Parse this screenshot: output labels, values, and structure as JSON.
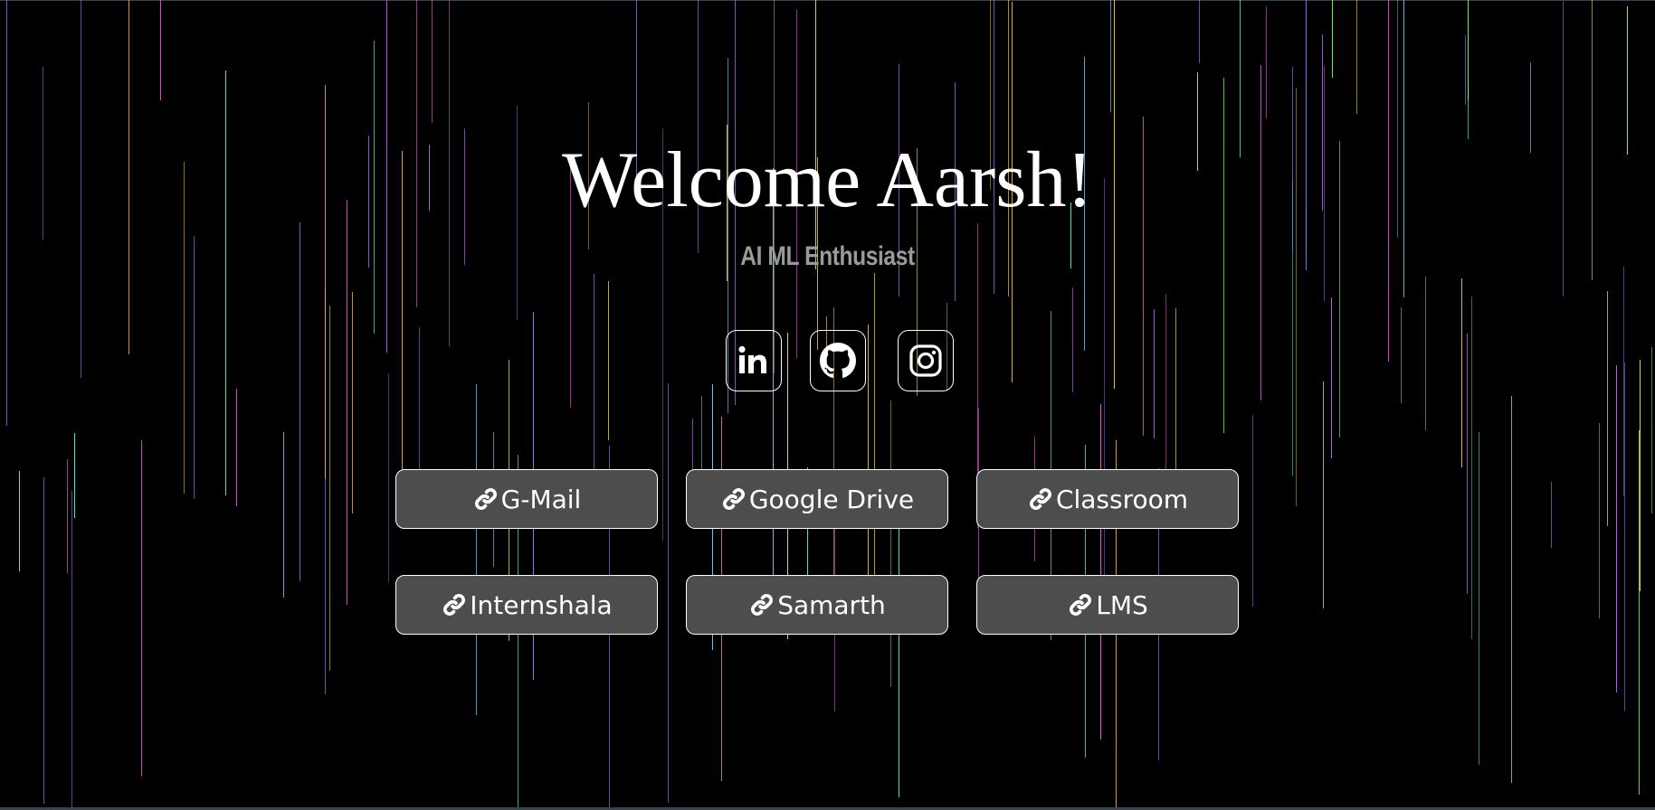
{
  "header": {
    "title": "Welcome Aarsh!",
    "subtitle": "AI ML Enthusiast"
  },
  "social": [
    {
      "name": "linkedin",
      "icon": "linkedin-icon"
    },
    {
      "name": "github",
      "icon": "github-icon"
    },
    {
      "name": "instagram",
      "icon": "instagram-icon"
    }
  ],
  "links": [
    {
      "label": "G-Mail",
      "icon": "link-icon"
    },
    {
      "label": "Google Drive",
      "icon": "link-icon"
    },
    {
      "label": "Classroom",
      "icon": "link-icon"
    },
    {
      "label": "Internshala",
      "icon": "link-icon"
    },
    {
      "label": "Samarth",
      "icon": "link-icon"
    },
    {
      "label": "LMS",
      "icon": "link-icon"
    }
  ],
  "theme": {
    "background": "#000000",
    "button_bg": "#4d4d4d",
    "button_border": "#ffffff",
    "title_color": "#ffffff",
    "subtitle_color": "#9a9a9a",
    "rain_colors": [
      "#ff5cf0",
      "#7cff6b",
      "#ffb347",
      "#8a7dff",
      "#4dffd2",
      "#ffe14d",
      "#c061ff",
      "#6bd3ff"
    ]
  }
}
